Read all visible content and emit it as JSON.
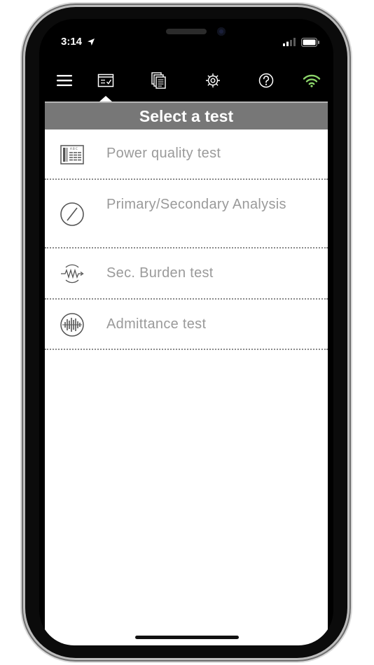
{
  "status_bar": {
    "time": "3:14",
    "location_icon": "location-arrow-icon",
    "signal_icon": "cellular-signal-icon",
    "battery_icon": "battery-icon"
  },
  "toolbar": {
    "items": [
      {
        "icon": "hamburger-menu-icon"
      },
      {
        "icon": "test-checklist-icon",
        "selected": true
      },
      {
        "icon": "documents-icon"
      },
      {
        "icon": "gear-icon"
      },
      {
        "icon": "help-circle-icon"
      },
      {
        "icon": "wifi-icon",
        "color": "#8cd46a"
      }
    ]
  },
  "header": {
    "title": "Select a test"
  },
  "tests": [
    {
      "label": "Power quality test",
      "icon": "power-quality-icon"
    },
    {
      "label": "Primary/Secondary Analysis",
      "icon": "slash-circle-icon"
    },
    {
      "label": "Sec. Burden test",
      "icon": "burden-resistor-icon"
    },
    {
      "label": "Admittance test",
      "icon": "admittance-waveform-icon"
    }
  ],
  "colors": {
    "header_bg": "#777777",
    "label_text": "#9a9a9a",
    "wifi_active": "#8cd46a",
    "frame": "#0b0b0b"
  }
}
